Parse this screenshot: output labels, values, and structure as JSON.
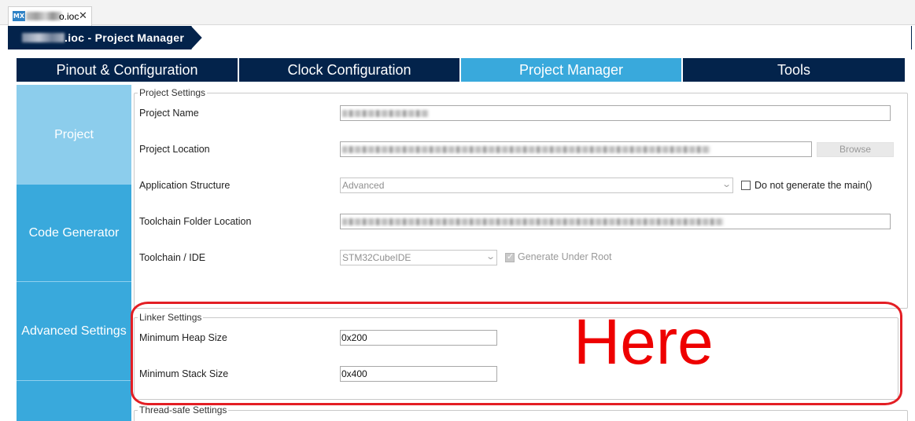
{
  "editor_tab": {
    "badge": "MX",
    "file_ext": "o.ioc",
    "close_glyph": "✕"
  },
  "breadcrumb": {
    "label": ".ioc - Project Manager"
  },
  "main_tabs": [
    {
      "label": "Pinout & Configuration",
      "active": false
    },
    {
      "label": "Clock Configuration",
      "active": false
    },
    {
      "label": "Project Manager",
      "active": true
    },
    {
      "label": "Tools",
      "active": false
    }
  ],
  "sidenav": {
    "items": [
      {
        "label": "Project",
        "active": true
      },
      {
        "label": "Code Generator",
        "active": false
      },
      {
        "label": "Advanced Settings",
        "active": false
      }
    ]
  },
  "project_settings": {
    "legend": "Project Settings",
    "project_name_label": "Project Name",
    "project_location_label": "Project Location",
    "browse_label": "Browse",
    "app_structure_label": "Application Structure",
    "app_structure_value": "Advanced",
    "no_main_label": "Do not generate the main()",
    "no_main_checked": false,
    "toolchain_folder_label": "Toolchain Folder Location",
    "toolchain_ide_label": "Toolchain / IDE",
    "toolchain_ide_value": "STM32CubeIDE",
    "generate_root_label": "Generate Under Root",
    "generate_root_checked": true
  },
  "linker_settings": {
    "legend": "Linker Settings",
    "heap_label": "Minimum Heap Size",
    "heap_value": "0x200",
    "stack_label": "Minimum Stack Size",
    "stack_value": "0x400"
  },
  "thread_safe_settings": {
    "legend": "Thread-safe Settings"
  },
  "annotation": {
    "text": "Here",
    "color": "#ee0000"
  },
  "colors": {
    "navy": "#03234b",
    "accent": "#39a9dc",
    "nav_active": "#8ccdec",
    "annotation_ring": "#e31e24"
  }
}
